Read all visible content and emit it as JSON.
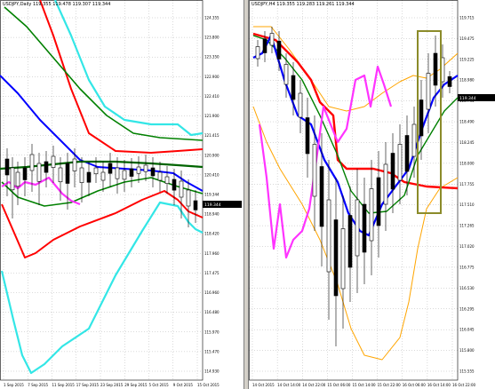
{
  "panes": [
    {
      "id": "left",
      "title": "USDJPY,Daily  119.355 119.478 119.307 119.344",
      "price_tag": "119.344",
      "y_ticks": [
        "124.355",
        "123.800",
        "123.350",
        "122.900",
        "122.410",
        "121.900",
        "121.415",
        "120.900",
        "120.410",
        "119.344",
        "118.940",
        "118.420",
        "117.960",
        "117.475",
        "116.960",
        "116.480",
        "115.970",
        "115.470",
        "114.930"
      ],
      "x_ticks": [
        "1 Sep 2015",
        "7 Sep 2015",
        "11 Sep 2015",
        "17 Sep 2015",
        "23 Sep 2015",
        "29 Sep 2015",
        "5 Oct 2015",
        "9 Oct 2015",
        "15 Oct 2015"
      ]
    },
    {
      "id": "right",
      "title": "USDJPY,H4  119.355 119.283 119.261 119.344",
      "price_tag": "119.344",
      "y_ticks": [
        "119.715",
        "119.475",
        "119.225",
        "118.980",
        "118.735",
        "118.490",
        "118.245",
        "118.000",
        "117.755",
        "117.510",
        "117.265",
        "117.020",
        "116.775",
        "116.530",
        "116.295",
        "116.045",
        "115.800",
        "115.555"
      ],
      "x_ticks": [
        "14 Oct 2015",
        "14 Oct 14:00",
        "14 Oct 22:00",
        "15 Oct 06:00",
        "15 Oct 14:00",
        "15 Oct 22:00",
        "16 Oct 06:00",
        "16 Oct 14:00",
        "16 Oct 22:00"
      ]
    }
  ],
  "colors": {
    "grid": "#b4b4b4",
    "candle": "#000000",
    "blue": "#0000ff",
    "red": "#ff0000",
    "darkred": "#cc0000",
    "green": "#008000",
    "cyan": "#33e6e6",
    "magenta": "#ff33ff",
    "orange": "#ffa500",
    "highlight": "#8b8b2a"
  }
}
